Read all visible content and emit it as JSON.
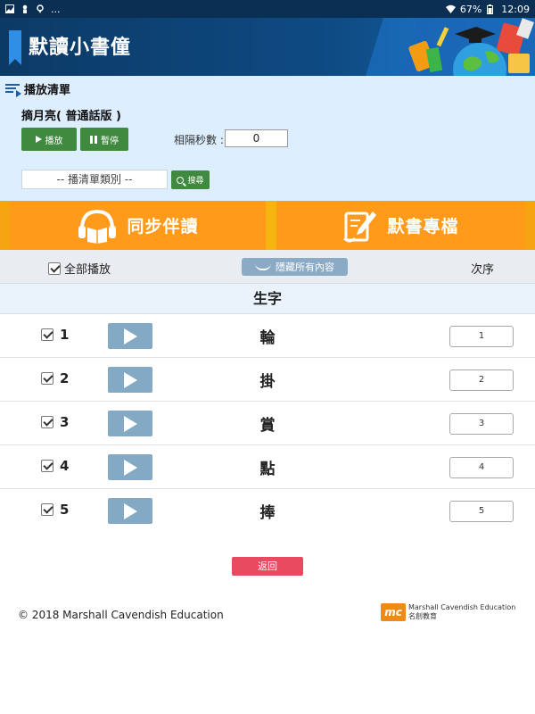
{
  "status_bar": {
    "time": "12:09",
    "battery": "67%",
    "more": "..."
  },
  "header": {
    "title": "默讀小書僮"
  },
  "playlist": {
    "heading": "播放清單",
    "title": "摘月亮( 普通話版 )",
    "play_label": "播放",
    "pause_label": "暫停",
    "interval_label": "相隔秒數 :",
    "interval_value": "0",
    "category_placeholder": "-- 播清單類別 --",
    "search_label": "搜尋"
  },
  "tabs": {
    "sync": "同步伴讀",
    "dictation": "默書專檔"
  },
  "table_header": {
    "play_all": "全部播放",
    "hide_all": "隱藏所有內容",
    "order": "次序"
  },
  "section": {
    "title": "生字"
  },
  "rows": [
    {
      "num": "1",
      "word": "輪",
      "order": "1",
      "checked": true
    },
    {
      "num": "2",
      "word": "掛",
      "order": "2",
      "checked": true
    },
    {
      "num": "3",
      "word": "賞",
      "order": "3",
      "checked": true
    },
    {
      "num": "4",
      "word": "點",
      "order": "4",
      "checked": true
    },
    {
      "num": "5",
      "word": "捧",
      "order": "5",
      "checked": true
    }
  ],
  "back_label": "返回",
  "footer": {
    "copyright": "© 2018 Marshall Cavendish Education",
    "logo_mark": "mc",
    "logo_en": "Marshall Cavendish Education",
    "logo_zh": "名創教育"
  },
  "colors": {
    "header": "#0c3a66",
    "tab_orange": "#ff9a1a",
    "green": "#3f8a3f",
    "back_red": "#e84a5f",
    "play_blue": "#84a9c5"
  }
}
